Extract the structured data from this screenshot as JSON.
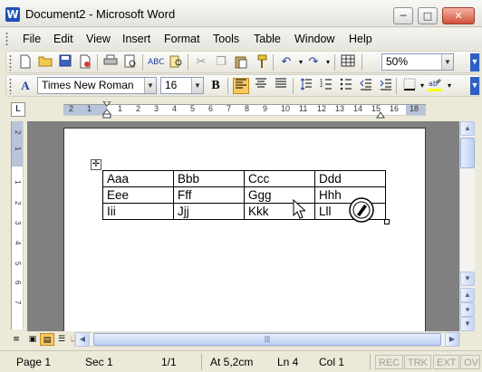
{
  "window": {
    "title": "Document2 - Microsoft Word",
    "app_icon_letter": "W"
  },
  "menu": {
    "items": [
      "File",
      "Edit",
      "View",
      "Insert",
      "Format",
      "Tools",
      "Table",
      "Window",
      "Help"
    ]
  },
  "standard_toolbar": {
    "zoom": "50%"
  },
  "formatting_toolbar": {
    "style_icon": "A",
    "font": "Times New Roman",
    "size": "16",
    "bold": "B"
  },
  "ruler": {
    "labels": [
      "2",
      "1",
      "1",
      "2",
      "3",
      "4",
      "5",
      "6",
      "7",
      "8",
      "9",
      "10",
      "11",
      "12",
      "13",
      "14",
      "15",
      "16",
      "18"
    ],
    "vertical_labels": [
      "2",
      "1",
      "1",
      "2",
      "3",
      "4",
      "5",
      "6",
      "7"
    ]
  },
  "table": {
    "rows": [
      [
        "Aaa",
        "Bbb",
        "Ccc",
        "Ddd"
      ],
      [
        "Eee",
        "Fff",
        "Ggg",
        "Hhh"
      ],
      [
        "Iii",
        "Jjj",
        "Kkk",
        "Lll"
      ]
    ]
  },
  "status": {
    "page": "Page 1",
    "sec": "Sec 1",
    "pages": "1/1",
    "at": "At 5,2cm",
    "ln": "Ln 4",
    "col": "Col 1",
    "rec": "REC",
    "trk": "TRK",
    "ext": "EXT",
    "ovr": "OVR"
  },
  "colors": {
    "accent": "#2f5fc4",
    "page_bg": "#808080",
    "ruler_margin": "#b7c4d9"
  },
  "icons": {
    "new": "new-document-icon",
    "open": "open-folder-icon",
    "save": "save-icon",
    "permission": "permission-icon",
    "print": "print-icon",
    "preview": "print-preview-icon",
    "spelling": "spelling-icon",
    "research": "research-icon",
    "cut": "cut-icon",
    "copy": "copy-icon",
    "paste": "paste-icon",
    "format_painter": "format-painter-icon",
    "undo": "undo-icon",
    "redo": "redo-icon",
    "insert_table": "insert-table-icon"
  }
}
